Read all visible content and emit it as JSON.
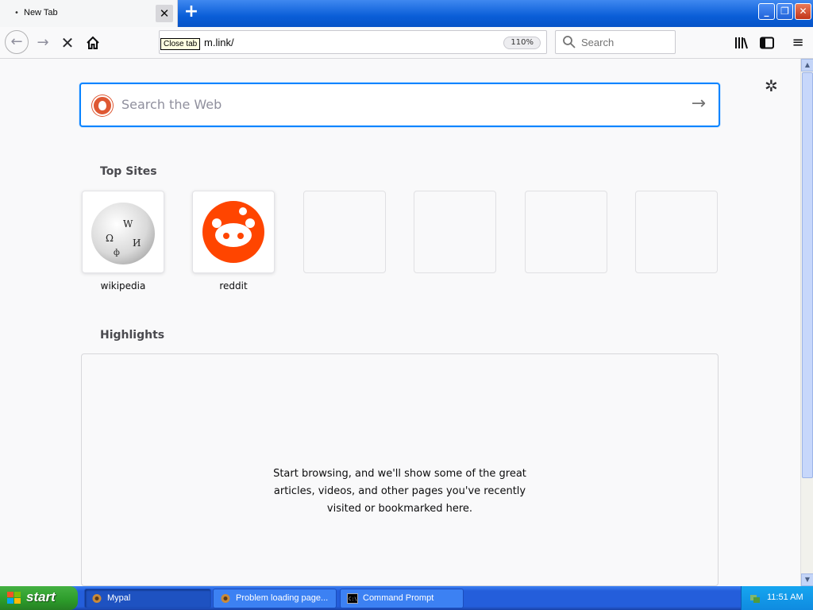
{
  "window": {
    "tab": {
      "title": "New Tab",
      "close_tooltip": "Close tab"
    }
  },
  "toolbar": {
    "url": "m.link/",
    "zoom": "110%",
    "search_placeholder": "Search"
  },
  "newtab": {
    "search_placeholder": "Search the Web",
    "top_sites_title": "Top Sites",
    "top_sites": [
      {
        "label": "wikipedia",
        "icon": "wikipedia-icon"
      },
      {
        "label": "reddit",
        "icon": "reddit-icon"
      },
      {
        "label": ""
      },
      {
        "label": ""
      },
      {
        "label": ""
      },
      {
        "label": ""
      }
    ],
    "highlights_title": "Highlights",
    "highlights_message": "Start browsing, and we'll show some of the great articles, videos, and other pages you've recently visited or bookmarked here."
  },
  "taskbar": {
    "start_label": "start",
    "tasks": [
      {
        "label": "Mypal",
        "active": true
      },
      {
        "label": "Problem loading page...",
        "active": false
      },
      {
        "label": "Command Prompt",
        "active": false
      }
    ],
    "clock": "11:51 AM"
  },
  "colors": {
    "accent": "#0a84ff",
    "reddit": "#ff4500",
    "duckduckgo": "#de5833",
    "xp_taskbar": "#245edb",
    "xp_start": "#2c9b2a"
  }
}
